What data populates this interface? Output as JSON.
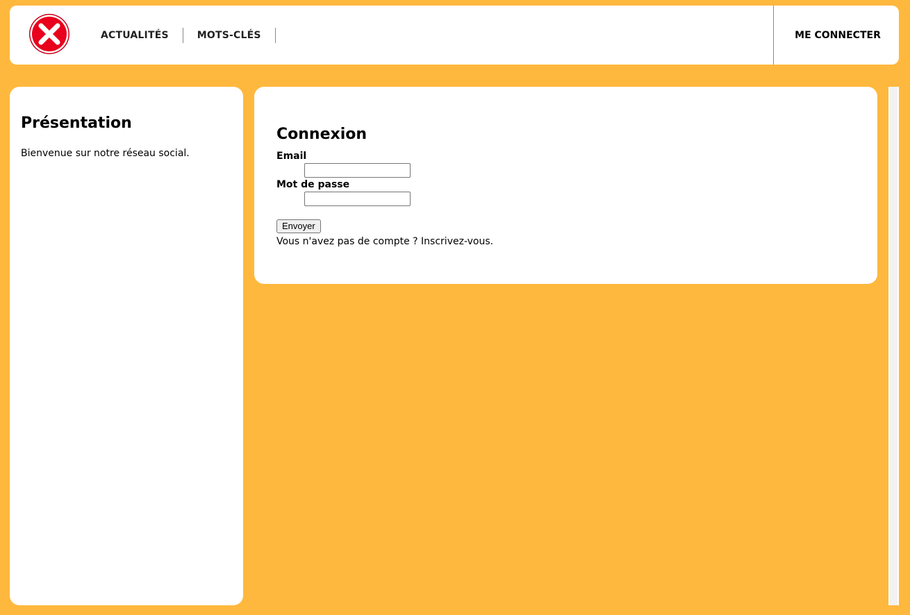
{
  "header": {
    "logo_icon": "red-x-icon",
    "nav": [
      {
        "label": "ACTUALITÉS"
      },
      {
        "label": "MOTS-CLÉS"
      }
    ],
    "login_label": "ME CONNECTER"
  },
  "sidebar": {
    "title": "Présentation",
    "text": "Bienvenue sur notre réseau social."
  },
  "main": {
    "title": "Connexion",
    "email_label": "Email",
    "email_value": "",
    "password_label": "Mot de passe",
    "password_value": "",
    "submit_label": "Envoyer",
    "signup_text": "Vous n'avez pas de compte ? Inscrivez-vous."
  },
  "colors": {
    "background": "#ffb83e",
    "panel": "#ffffff",
    "logo_red": "#e8001c"
  }
}
